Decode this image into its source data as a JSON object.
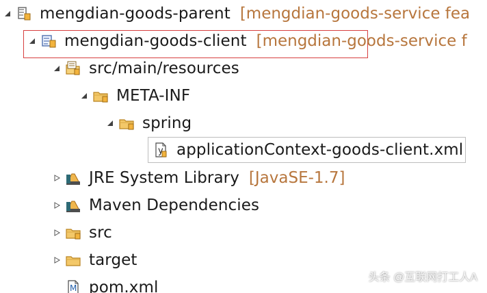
{
  "tree": {
    "rows": [
      {
        "label": "mengdian-goods-parent",
        "decoration": "[mengdian-goods-service fea",
        "toggle": "expanded",
        "icon": "maven-project-icon"
      },
      {
        "label": "mengdian-goods-client",
        "decoration": "[mengdian-goods-service f",
        "toggle": "expanded",
        "icon": "maven-module-icon"
      },
      {
        "label": "src/main/resources",
        "toggle": "expanded",
        "icon": "source-folder-icon"
      },
      {
        "label": "META-INF",
        "toggle": "expanded",
        "icon": "folder-icon"
      },
      {
        "label": "spring",
        "toggle": "expanded",
        "icon": "folder-icon"
      },
      {
        "label": "applicationContext-goods-client.xml",
        "toggle": "none",
        "icon": "xml-file-icon"
      },
      {
        "label": "JRE System Library",
        "decoration": "[JavaSE-1.7]",
        "toggle": "collapsed",
        "icon": "library-icon"
      },
      {
        "label": "Maven Dependencies",
        "toggle": "collapsed",
        "icon": "library-icon"
      },
      {
        "label": "src",
        "toggle": "collapsed",
        "icon": "folder-icon"
      },
      {
        "label": "target",
        "toggle": "collapsed",
        "icon": "folder-icon"
      },
      {
        "label": "pom.xml",
        "toggle": "none",
        "icon": "pom-file-icon"
      }
    ]
  },
  "watermark": "头条 @互联网打工人A",
  "colors": {
    "highlight_border": "#d73f3f",
    "decoration_text": "#b7763d",
    "folder_fill": "#f3c869",
    "library_fill": "#f0b64d"
  }
}
